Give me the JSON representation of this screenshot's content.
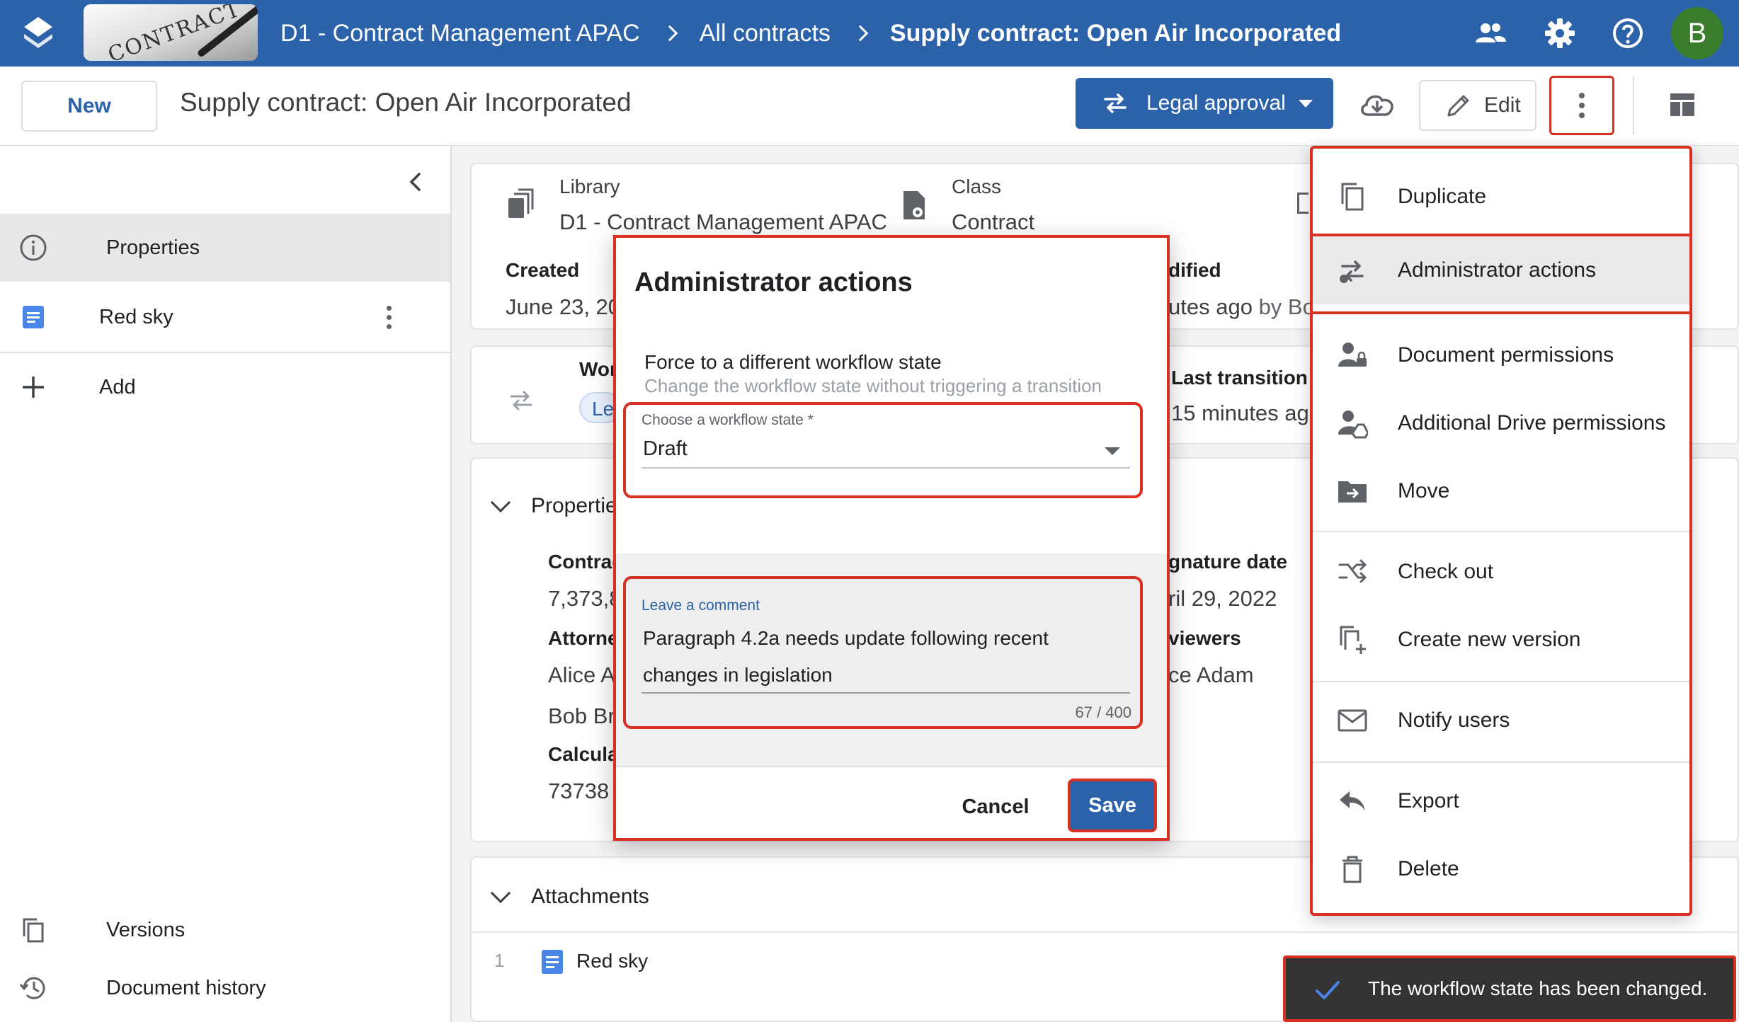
{
  "breadcrumb": {
    "thumbnail_text": "CONTRACT",
    "items": [
      "D1 - Contract Management APAC",
      "All contracts",
      "Supply contract: Open Air Incorporated"
    ]
  },
  "user": {
    "initial": "B",
    "color": "#3a7d2c"
  },
  "toolbar": {
    "new_label": "New",
    "document_title": "Supply contract: Open Air Incorporated",
    "workflow_label": "Legal approval",
    "edit_label": "Edit"
  },
  "sidebar": {
    "items": [
      {
        "label": "Properties",
        "icon": "info-icon"
      },
      {
        "label": "Red sky",
        "icon": "doc-icon"
      },
      {
        "label": "Add",
        "icon": "plus-icon"
      },
      {
        "label": "Versions",
        "icon": "versions-icon"
      },
      {
        "label": "Document history",
        "icon": "history-icon"
      }
    ]
  },
  "info_card": {
    "library_label": "Library",
    "library_value": "D1 - Contract Management APAC",
    "class_label": "Class",
    "class_value": "Contract",
    "created_label": "Created",
    "created_value": "June 23, 20",
    "modified_label": "dified",
    "modified_value": "utes ago",
    "modified_by": "by Bob"
  },
  "workflow_card": {
    "workflow_label": "Wor",
    "chip": "Le",
    "last_transition_label": "Last transition",
    "last_transition_value": "15 minutes ago"
  },
  "properties_card": {
    "heading": "Propertie",
    "contract_label": "Contrac",
    "contract_value": "7,373,8",
    "attorney_label": "Attorne",
    "attorney_1": "Alice A",
    "attorney_2": "Bob Br",
    "calc_label": "Calcula",
    "calc_value": "73738",
    "signature_label": "gnature date",
    "signature_value": "ril 29, 2022",
    "reviewers_label": "viewers",
    "reviewers_value": "ce Adam"
  },
  "attachments": {
    "heading": "Attachments",
    "rows": [
      {
        "index": "1",
        "name": "Red sky"
      }
    ]
  },
  "dialog": {
    "title": "Administrator actions",
    "force_title": "Force to a different workflow state",
    "force_subtitle": "Change the workflow state without triggering a transition",
    "select_label": "Choose a workflow state *",
    "select_value": "Draft",
    "comment_label": "Leave a comment",
    "comment_text": "Paragraph 4.2a needs update following recent changes in legislation",
    "comment_count": "67 / 400",
    "cancel_label": "Cancel",
    "save_label": "Save"
  },
  "menu": {
    "items": [
      {
        "label": "Duplicate",
        "icon": "duplicate-icon"
      },
      {
        "label": "Administrator actions",
        "icon": "admin-actions-icon"
      },
      {
        "label": "Document permissions",
        "icon": "document-permissions-icon"
      },
      {
        "label": "Additional Drive permissions",
        "icon": "drive-permissions-icon"
      },
      {
        "label": "Move",
        "icon": "move-folder-icon"
      },
      {
        "label": "Check out",
        "icon": "check-out-icon"
      },
      {
        "label": "Create new version",
        "icon": "new-version-icon"
      },
      {
        "label": "Notify users",
        "icon": "mail-icon"
      },
      {
        "label": "Export",
        "icon": "export-icon"
      },
      {
        "label": "Delete",
        "icon": "trash-icon"
      }
    ]
  },
  "snackbar": {
    "message": "The workflow state has been changed."
  },
  "colors": {
    "brand": "#2b62a9",
    "highlight": "#d93025",
    "snackbar": "#333333"
  }
}
